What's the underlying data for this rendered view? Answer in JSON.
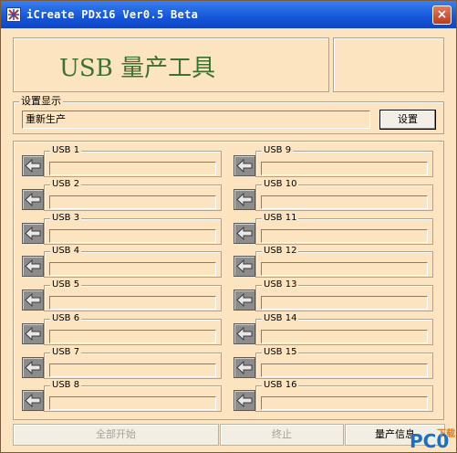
{
  "window": {
    "title": "iCreate PDx16 Ver0.5 Beta",
    "close_glyph": "×"
  },
  "banner": {
    "title": "USB 量产工具"
  },
  "settings": {
    "group_label": "设置显示",
    "value": "重新生产",
    "button_label": "设置"
  },
  "ports": [
    {
      "label": "USB 1"
    },
    {
      "label": "USB 2"
    },
    {
      "label": "USB 3"
    },
    {
      "label": "USB 4"
    },
    {
      "label": "USB 5"
    },
    {
      "label": "USB 6"
    },
    {
      "label": "USB 7"
    },
    {
      "label": "USB 8"
    },
    {
      "label": "USB 9"
    },
    {
      "label": "USB 10"
    },
    {
      "label": "USB 11"
    },
    {
      "label": "USB 12"
    },
    {
      "label": "USB 13"
    },
    {
      "label": "USB 14"
    },
    {
      "label": "USB 15"
    },
    {
      "label": "USB 16"
    }
  ],
  "buttons": {
    "start_all": "全部开始",
    "stop": "终止",
    "production_info": "量产信息"
  },
  "watermark": {
    "main": "PC0",
    "sub": "下载"
  },
  "colors": {
    "window_bg": "#fce4c0",
    "title_bar": "#1556d8",
    "banner_text": "#3e7030"
  }
}
